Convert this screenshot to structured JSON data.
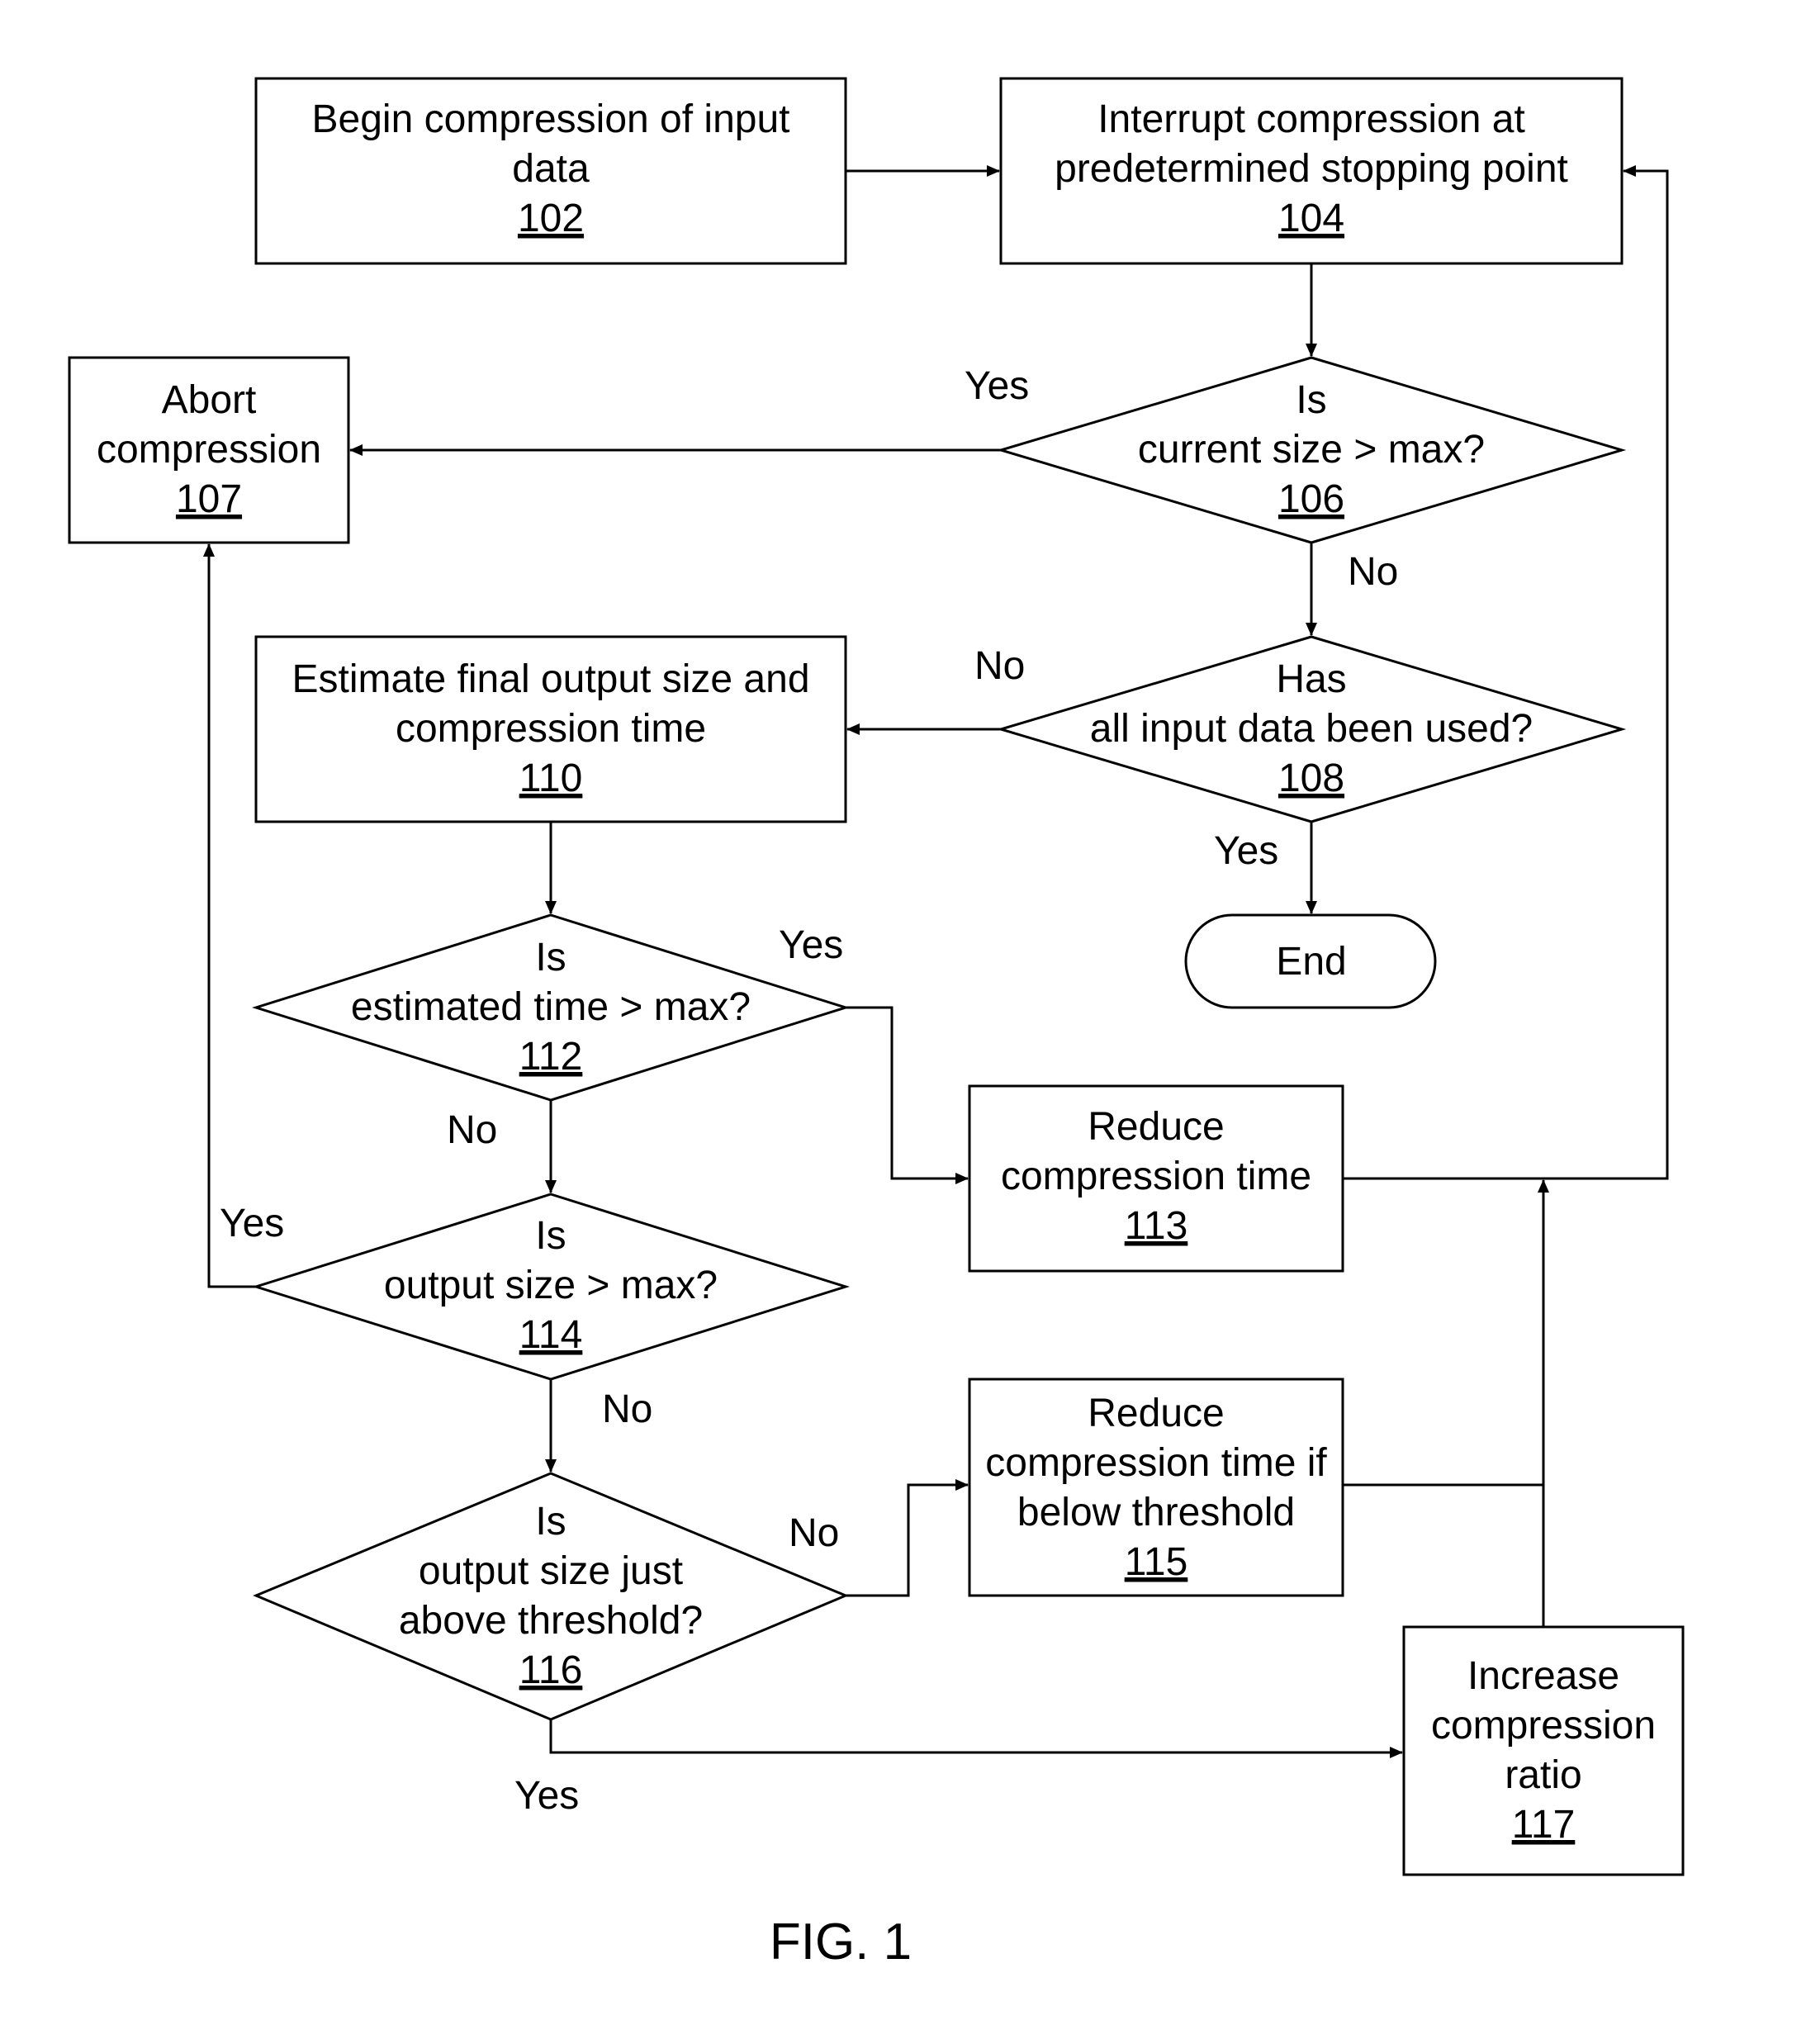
{
  "figure_label": "FIG. 1",
  "nodes": {
    "n102": {
      "type": "process",
      "lines": [
        "Begin compression of input",
        "data"
      ],
      "ref": "102"
    },
    "n104": {
      "type": "process",
      "lines": [
        "Interrupt compression at",
        "predetermined stopping point"
      ],
      "ref": "104"
    },
    "n106": {
      "type": "decision",
      "lines": [
        "Is",
        "current size > max?"
      ],
      "ref": "106"
    },
    "n107": {
      "type": "process",
      "lines": [
        "Abort",
        "compression"
      ],
      "ref": "107"
    },
    "n108": {
      "type": "decision",
      "lines": [
        "Has",
        "all input data been used?"
      ],
      "ref": "108"
    },
    "n110": {
      "type": "process",
      "lines": [
        "Estimate final output size and",
        "compression time"
      ],
      "ref": "110"
    },
    "nEnd": {
      "type": "terminal",
      "lines": [
        "End"
      ]
    },
    "n112": {
      "type": "decision",
      "lines": [
        "Is",
        "estimated time > max?"
      ],
      "ref": "112"
    },
    "n113": {
      "type": "process",
      "lines": [
        "Reduce",
        "compression time"
      ],
      "ref": "113"
    },
    "n114": {
      "type": "decision",
      "lines": [
        "Is",
        "output size > max?"
      ],
      "ref": "114"
    },
    "n115": {
      "type": "process",
      "lines": [
        "Reduce",
        "compression time if",
        "below threshold"
      ],
      "ref": "115"
    },
    "n116": {
      "type": "decision",
      "lines": [
        "Is",
        "output size just",
        "above threshold?"
      ],
      "ref": "116"
    },
    "n117": {
      "type": "process",
      "lines": [
        "Increase",
        "compression",
        "ratio"
      ],
      "ref": "117"
    }
  },
  "edge_labels": {
    "e106_yes": "Yes",
    "e106_no": "No",
    "e108_no": "No",
    "e108_yes": "Yes",
    "e112_yes": "Yes",
    "e112_no": "No",
    "e114_yes": "Yes",
    "e114_no": "No",
    "e116_no": "No",
    "e116_yes": "Yes"
  },
  "edges": [
    {
      "from": "102",
      "to": "104"
    },
    {
      "from": "104",
      "to": "106"
    },
    {
      "from": "106",
      "to": "107",
      "label": "Yes"
    },
    {
      "from": "106",
      "to": "108",
      "label": "No"
    },
    {
      "from": "108",
      "to": "110",
      "label": "No"
    },
    {
      "from": "108",
      "to": "End",
      "label": "Yes"
    },
    {
      "from": "110",
      "to": "112"
    },
    {
      "from": "112",
      "to": "113",
      "label": "Yes"
    },
    {
      "from": "112",
      "to": "114",
      "label": "No"
    },
    {
      "from": "114",
      "to": "107",
      "label": "Yes"
    },
    {
      "from": "114",
      "to": "116",
      "label": "No"
    },
    {
      "from": "116",
      "to": "115",
      "label": "No"
    },
    {
      "from": "116",
      "to": "117",
      "label": "Yes"
    },
    {
      "from": "113",
      "to": "104"
    },
    {
      "from": "115",
      "to": "104"
    },
    {
      "from": "117",
      "to": "104"
    }
  ]
}
